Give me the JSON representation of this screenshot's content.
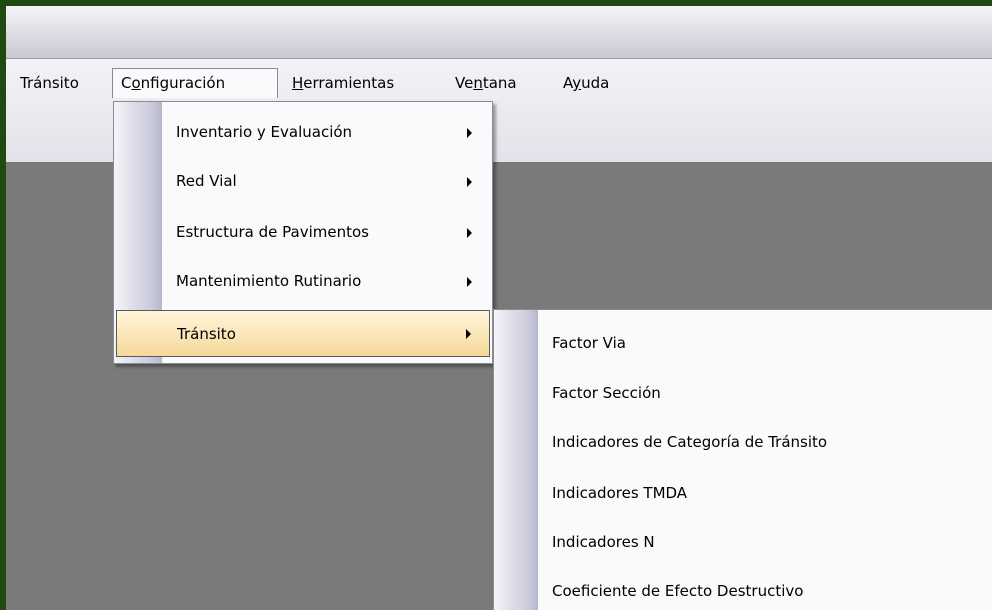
{
  "menubar": {
    "items": [
      {
        "id": "transito",
        "pre": "Tránsito",
        "u": "",
        "post": ""
      },
      {
        "id": "configuracion",
        "pre": "C",
        "u": "o",
        "post": "nfiguración"
      },
      {
        "id": "herramientas",
        "pre": "",
        "u": "H",
        "post": "erramientas"
      },
      {
        "id": "ventana",
        "pre": "Ve",
        "u": "n",
        "post": "tana"
      },
      {
        "id": "ayuda",
        "pre": "A",
        "u": "y",
        "post": "uda"
      }
    ]
  },
  "config_menu": {
    "items": [
      {
        "label": "Inventario y Evaluación",
        "has_submenu": true
      },
      {
        "label": "Red Vial",
        "has_submenu": true
      },
      {
        "label": "Estructura de Pavimentos",
        "has_submenu": true
      },
      {
        "label": "Mantenimiento Rutinario",
        "has_submenu": true
      },
      {
        "label": "Tránsito",
        "has_submenu": true,
        "highlighted": true
      }
    ]
  },
  "transito_submenu": {
    "items": [
      {
        "label": "Factor Via"
      },
      {
        "label": "Factor Sección"
      },
      {
        "label": "Indicadores de Categoría de Tránsito"
      },
      {
        "label": "Indicadores TMDA"
      },
      {
        "label": "Indicadores N"
      },
      {
        "label": "Coeficiente de Efecto Destructivo"
      }
    ]
  },
  "child_window": {
    "icon": "app-window-icon"
  },
  "colors": {
    "desktop": "#1f4a12",
    "workspace": "#7a7a7a",
    "highlight": "#f6d89a"
  }
}
